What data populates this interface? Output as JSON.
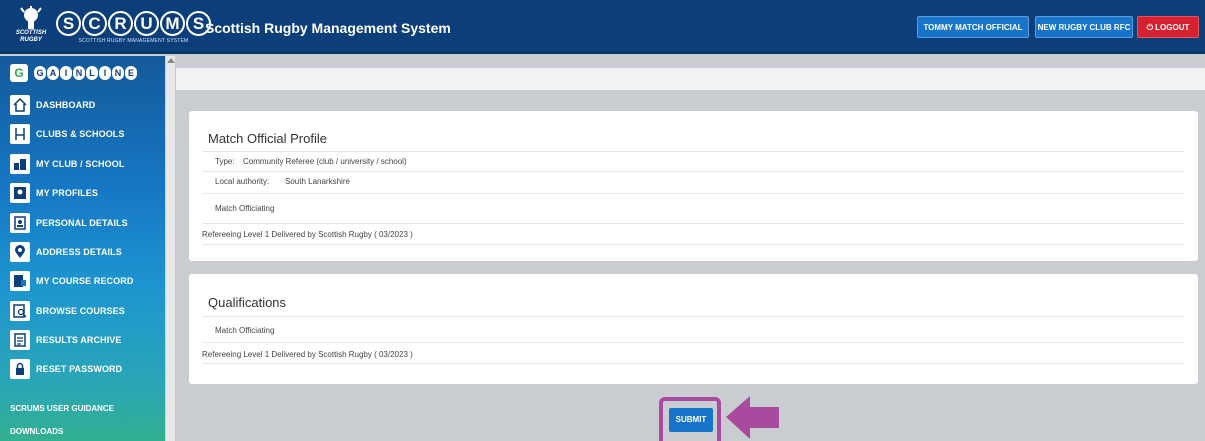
{
  "header": {
    "logo_badge": "SCOTTISH RUGBY",
    "logo_letters": [
      "S",
      "C",
      "R",
      "U",
      "M",
      "S"
    ],
    "logo_tagline": "SCOTTISH RUGBY MANAGEMENT SYSTEM",
    "app_title": "Scottish Rugby Management System",
    "user_button": "TOMMY MATCH OFFICIAL",
    "club_button": "NEW RUGBY CLUB RFC",
    "logout_button": "LOGOUT",
    "logout_icon": "power-icon"
  },
  "sidebar": {
    "brand_letter": "G",
    "brand_letters": [
      "G",
      "A",
      "I",
      "N",
      "L",
      "I",
      "N",
      "E"
    ],
    "items": [
      {
        "label": "DASHBOARD",
        "icon": "dashboard-icon"
      },
      {
        "label": "CLUBS & SCHOOLS",
        "icon": "goalpost-icon"
      },
      {
        "label": "MY CLUB / SCHOOL",
        "icon": "club-icon"
      },
      {
        "label": "MY PROFILES",
        "icon": "profiles-icon"
      },
      {
        "label": "PERSONAL DETAILS",
        "icon": "personal-details-icon"
      },
      {
        "label": "ADDRESS DETAILS",
        "icon": "map-pin-icon"
      },
      {
        "label": "MY COURSE RECORD",
        "icon": "course-record-icon"
      },
      {
        "label": "BROWSE COURSES",
        "icon": "browse-courses-icon"
      },
      {
        "label": "RESULTS ARCHIVE",
        "icon": "archive-icon"
      },
      {
        "label": "RESET PASSWORD",
        "icon": "lock-icon"
      }
    ],
    "links": [
      "SCRUMS USER GUIDANCE",
      "DOWNLOADS"
    ]
  },
  "profile_card": {
    "title": "Match Official Profile",
    "type_label": "Type:",
    "type_value": "Community Referee (club / university / school)",
    "authority_label": "Local authority:",
    "authority_value": "South Lanarkshire",
    "section": "Match Officiating",
    "qualification": "Refereeing Level 1 Delivered by Scottish Rugby ( 03/2023 )"
  },
  "qualifications_card": {
    "title": "Qualifications",
    "section": "Match Officiating",
    "qualification": "Refereeing Level 1 Delivered by Scottish Rugby ( 03/2023 )"
  },
  "submit_button": "SUBMIT",
  "colors": {
    "header": "#0c3f7a",
    "button_blue": "#1774c9",
    "logout_red": "#d62230",
    "highlight": "#a84a9e"
  }
}
